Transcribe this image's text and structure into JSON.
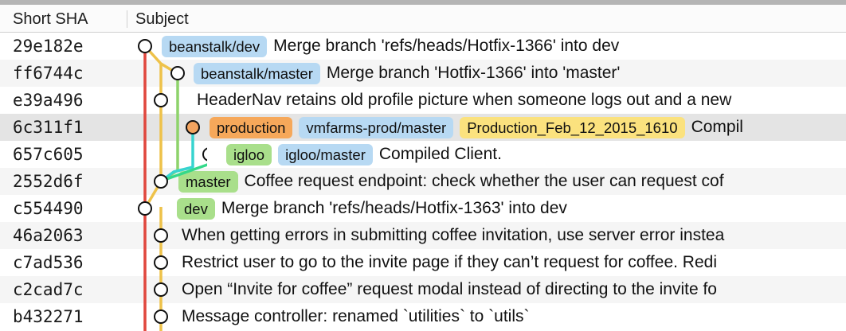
{
  "header": {
    "col_sha": "Short SHA",
    "col_subject": "Subject"
  },
  "colors": {
    "red": "#e0463d",
    "yellow": "#eec24a",
    "green": "#8ed36b",
    "teal": "#37d4cf",
    "mint": "#34d98a",
    "orange_node": "#f3a460"
  },
  "commits": [
    {
      "sha": "29e182e",
      "refs": [
        {
          "label": "beanstalk/dev",
          "color": "blue"
        }
      ],
      "subject": "Merge branch 'refs/heads/Hotfix-1366' into dev"
    },
    {
      "sha": "ff6744c",
      "refs": [
        {
          "label": "beanstalk/master",
          "color": "blue"
        }
      ],
      "subject": "Merge branch 'Hotfix-1366' into 'master'"
    },
    {
      "sha": "e39a496",
      "refs": [],
      "subject": "HeaderNav retains old profile picture when someone logs out and a new"
    },
    {
      "sha": "6c311f1",
      "refs": [
        {
          "label": "production",
          "color": "orange"
        },
        {
          "label": "vmfarms-prod/master",
          "color": "blue"
        },
        {
          "label": "Production_Feb_12_2015_1610",
          "color": "yellow"
        }
      ],
      "subject": "Compil"
    },
    {
      "sha": "657c605",
      "refs": [
        {
          "label": "igloo",
          "color": "green"
        },
        {
          "label": "igloo/master",
          "color": "blue"
        }
      ],
      "subject": "Compiled Client."
    },
    {
      "sha": "2552d6f",
      "refs": [
        {
          "label": "master",
          "color": "green"
        }
      ],
      "subject": "Coffee request endpoint: check whether the user can request cof"
    },
    {
      "sha": "c554490",
      "refs": [
        {
          "label": "dev",
          "color": "green"
        }
      ],
      "subject": "Merge branch 'refs/heads/Hotfix-1363' into dev"
    },
    {
      "sha": "46a2063",
      "refs": [],
      "subject": "When getting errors in submitting coffee invitation, use server error instea"
    },
    {
      "sha": "c7ad536",
      "refs": [],
      "subject": "Restrict user to go to the invite page if they can’t request for coffee. Redi"
    },
    {
      "sha": "c2cad7c",
      "refs": [],
      "subject": "Open “Invite for coffee” request modal instead of directing to the invite fo"
    },
    {
      "sha": "b432271",
      "refs": [],
      "subject": "Message controller: renamed `utilities` to `utils`"
    }
  ]
}
